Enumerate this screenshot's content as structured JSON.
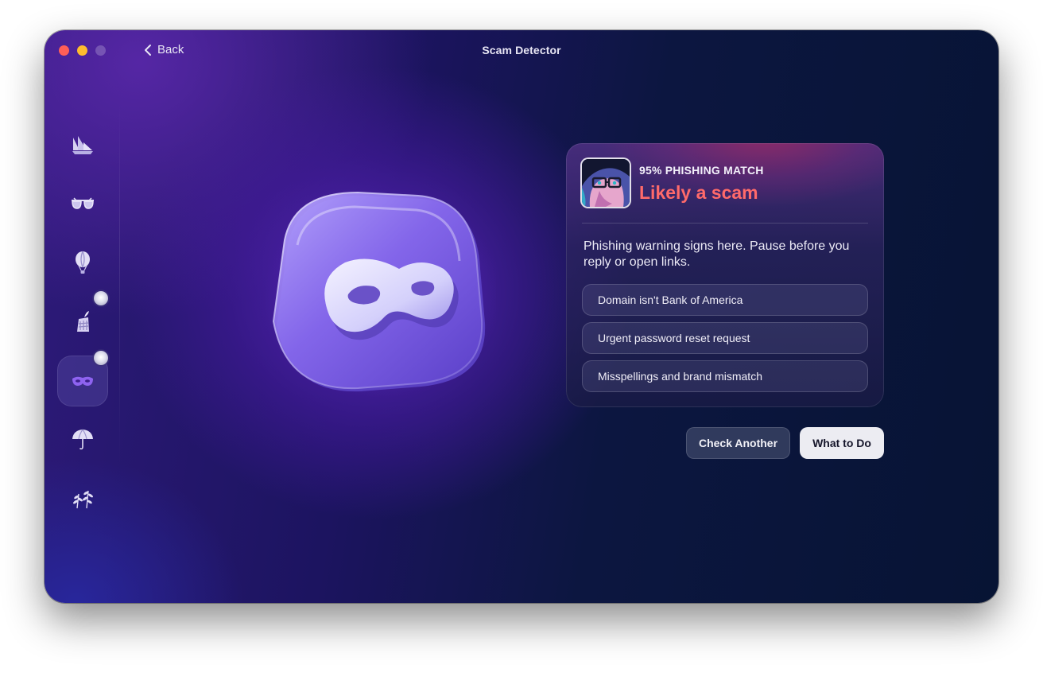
{
  "window": {
    "title": "Scam Detector",
    "back_label": "Back"
  },
  "sidebar": {
    "items": [
      {
        "icon": "sailboat-icon"
      },
      {
        "icon": "sunglasses-icon"
      },
      {
        "icon": "hot-air-balloon-icon"
      },
      {
        "icon": "building-icon",
        "badge": true
      },
      {
        "icon": "mask-icon",
        "badge": true,
        "active": true
      },
      {
        "icon": "umbrella-icon"
      },
      {
        "icon": "leaves-icon"
      }
    ]
  },
  "hero": {
    "icon": "mask-icon"
  },
  "result": {
    "match_label": "95% PHISHING MATCH",
    "verdict": "Likely a scam",
    "verdict_color": "#ff6a6a",
    "description": "Phishing warning signs here. Pause before you reply or open links.",
    "reasons": [
      "Domain isn't Bank of America",
      "Urgent password reset request",
      "Misspellings and brand mismatch"
    ]
  },
  "actions": {
    "secondary_label": "Check Another",
    "primary_label": "What to Do"
  }
}
